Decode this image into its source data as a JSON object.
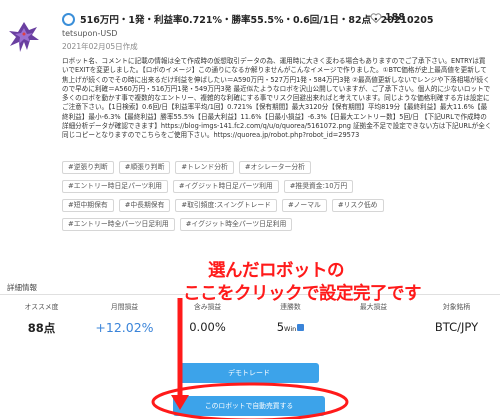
{
  "header": {
    "title": "516万円・1発・利益率0.721%・勝率55.5%・0.6回/1日・82点・20210205",
    "like_count": "188",
    "owner": "tetsupon-USD",
    "created": "2021年02月05日作成"
  },
  "description": "ロボット名、コメントに記載の情報は全て作成時の仮想取引データの為、運用時に大きく変わる場合もありますのでご了承下さい。ENTRYは買いでEXITを変更しました。【ロボのイメージ】この通りになるか解りませんがこんなイメージで作りました。①BTC価格が史上最高値を更新して焦上げが続くのでその時に出来るだけ利益を伸ばしたい＝A590万円・527万円1発・584万円3発 ②最高値更新しないでレンジや下落相場が続くので早めに利確＝A560万円・516万円1発・549万円3発 最近似たようなロボを沢山公開していますが、ご了承下さい。個人的に少ないロットで多くのロボを動かす事で複数的なエントリー、複雑的な利確にする事でリスク回避出来ればと考えています。同じような価格利確する方は設定にご注意下さい。【1日検索】0.6回/日【利益率平均/1回】0.721%【保有期間】最大3120分【保有期間】平均819分【最終利益】最大11.6%【最終利益】最小-6.3%【最終利益】勝率55.5%【日最大利益】11.6%【日最小損益】-6.3%【日最大エントリー数】5回/日 【下記URLで作成時の詳細分析データが確認できます】https://blog-imgs-141.fc2.com/q/u/o/quorea/5161072.png 証拠金不足で設定できない方は下記URLが全く同じコピーとなりますのでこちらをご使用下さい。https://quorea.jp/robot.php?robot_id=29573",
  "tags": [
    [
      "#逆張り判断",
      "#順張り判断",
      "#トレンド分析",
      "#オシレーター分析"
    ],
    [
      "#エントリー時日足パーツ利用",
      "#イグジット時日足パーツ利用",
      "#推奨資金:10万円"
    ],
    [
      "#短中期保有",
      "#中長期保有",
      "#取引頻度:スイングトレード",
      "#ノーマル",
      "#リスク低め"
    ],
    [
      "#エントリー時全パーツ日足利用",
      "#イグジット時全パーツ日足利用"
    ]
  ],
  "details": {
    "label": "詳細情報",
    "stats": [
      {
        "label": "オススメ度",
        "value": "88点"
      },
      {
        "label": "月間損益",
        "value": "+12.02%"
      },
      {
        "label": "含み損益",
        "value": "0.00%"
      },
      {
        "label": "連勝数",
        "value": "5",
        "suffix": "Win"
      },
      {
        "label": "最大損益",
        "value": ""
      },
      {
        "label": "対象銘柄",
        "value": "BTC/JPY"
      }
    ]
  },
  "buttons": {
    "demo": "デモトレード",
    "activate": "このロボットで自動売買する"
  },
  "annotation": {
    "line1": "選んだロボットの",
    "line2": "ここをクリックで設定完了です"
  },
  "colors": {
    "accent_blue": "#3ca3ea",
    "annotation_red": "#ff1a1a",
    "profit_blue": "#3a84d9"
  },
  "icons": {
    "avatar": "dragon-avatar",
    "status": "status-circle-icon",
    "like": "heart-icon",
    "win": "thumb-up-icon"
  }
}
